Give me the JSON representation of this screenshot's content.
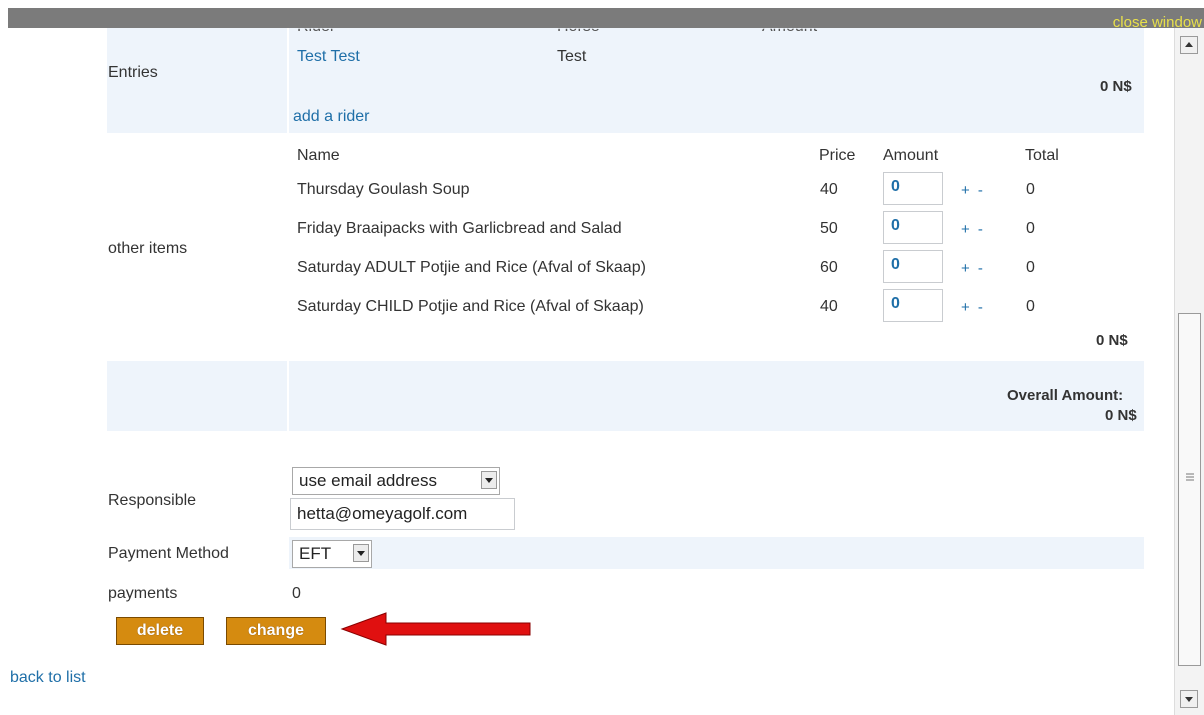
{
  "topbar": {
    "close_label": "close window"
  },
  "entries": {
    "label": "Entries",
    "col_rider": "Rider",
    "col_horse": "Horse",
    "col_amount": "Amount",
    "rider": "Test Test",
    "horse": "Test",
    "total": "0 N$",
    "add_rider": "add a rider"
  },
  "other_items": {
    "label": "other items",
    "headers": {
      "name": "Name",
      "price": "Price",
      "amount": "Amount",
      "total": "Total"
    },
    "rows": [
      {
        "name": "Thursday Goulash Soup",
        "price": "40",
        "amount": "0",
        "plus_minus": "+ -",
        "total": "0"
      },
      {
        "name": "Friday Braaipacks with Garlicbread and Salad",
        "price": "50",
        "amount": "0",
        "plus_minus": "+ -",
        "total": "0"
      },
      {
        "name": "Saturday ADULT Potjie and Rice (Afval of Skaap)",
        "price": "60",
        "amount": "0",
        "plus_minus": "+ -",
        "total": "0"
      },
      {
        "name": "Saturday CHILD Potjie and Rice (Afval of Skaap)",
        "price": "40",
        "amount": "0",
        "plus_minus": "+ -",
        "total": "0"
      }
    ],
    "subtotal": "0 N$"
  },
  "overall": {
    "label": "Overall Amount:",
    "value": "0 N$"
  },
  "responsible": {
    "label": "Responsible",
    "select_value": "use email address",
    "email": "hetta@omeyagolf.com"
  },
  "payment_method": {
    "label": "Payment Method",
    "value": "EFT"
  },
  "payments": {
    "label": "payments",
    "value": "0"
  },
  "buttons": {
    "delete": "delete",
    "change": "change"
  },
  "back_link": "back to list",
  "colors": {
    "topbar": "#7b7b7b",
    "close_link": "#e8e04a",
    "link": "#1f6fa8",
    "button": "#d58b10",
    "row_shade": "#eef4fb",
    "arrow": "#e01010"
  }
}
